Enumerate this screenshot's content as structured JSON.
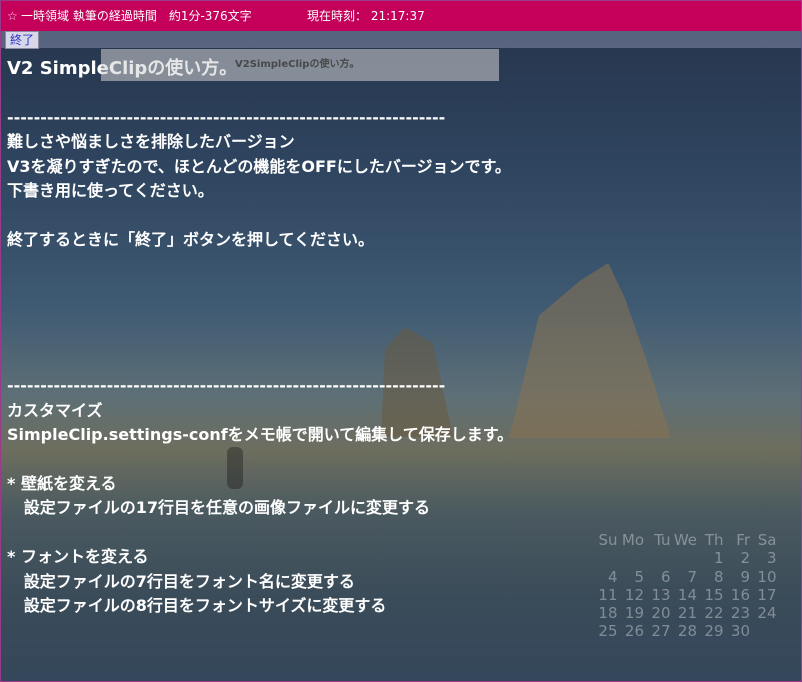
{
  "titlebar": {
    "title": "一時領域 執筆の経過時間　約1分-376文字",
    "clock": "現在時刻：  21:17:37"
  },
  "toolbar": {
    "end_label": "終了"
  },
  "tooltip": {
    "text": "V2SimpleClipの使い方。"
  },
  "editor": {
    "lines": [
      "V2 SimpleClipの使い方。",
      "",
      "------------------------------------------------------------------",
      "難しさや悩ましさを排除したバージョン",
      "V3を凝りすぎたので、ほとんどの機能をOFFにしたバージョンです。",
      "下書き用に使ってください。",
      "",
      "終了するときに「終了」ボタンを押してください。",
      "",
      "",
      "",
      "",
      "",
      "------------------------------------------------------------------",
      "カスタマイズ",
      "SimpleClip.settings-confをメモ帳で開いて編集して保存します。",
      "",
      "* 壁紙を変える",
      "   設定ファイルの17行目を任意の画像ファイルに変更する",
      "",
      "* フォントを変える",
      "   設定ファイルの7行目をフォント名に変更する",
      "   設定ファイルの8行目をフォントサイズに変更する"
    ]
  },
  "calendar": {
    "weekdays": [
      "Su",
      "Mo",
      "Tu",
      "We",
      "Th",
      "Fr",
      "Sa"
    ],
    "weeks": [
      [
        "",
        "",
        "",
        "",
        "1",
        "2",
        "3"
      ],
      [
        "4",
        "5",
        "6",
        "7",
        "8",
        "9",
        "10"
      ],
      [
        "11",
        "12",
        "13",
        "14",
        "15",
        "16",
        "17"
      ],
      [
        "18",
        "19",
        "20",
        "21",
        "22",
        "23",
        "24"
      ],
      [
        "25",
        "26",
        "27",
        "28",
        "29",
        "30",
        ""
      ]
    ]
  }
}
